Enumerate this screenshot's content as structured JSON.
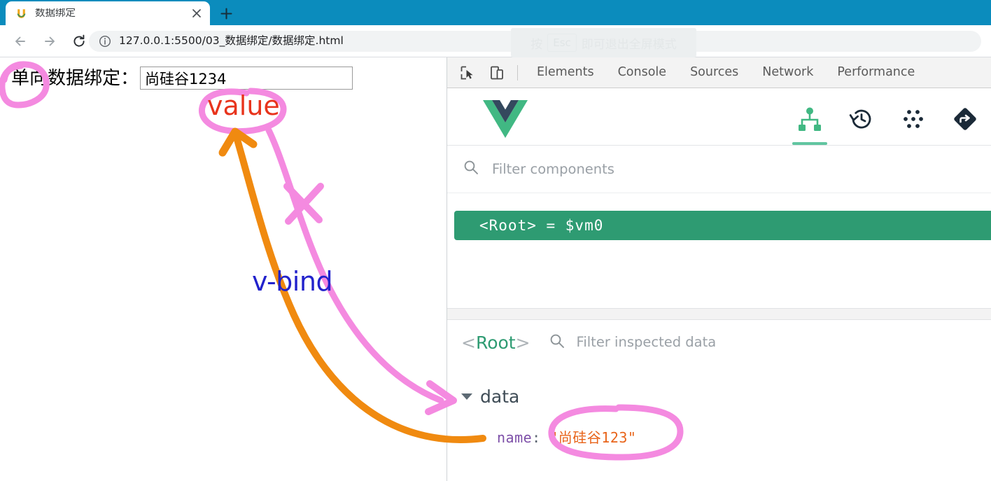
{
  "browser": {
    "tab": {
      "title": "数据绑定",
      "favicon_icon": "u-logo-favicon",
      "close_icon": "close-icon"
    },
    "new_tab_label": "+",
    "nav": {
      "back_icon": "arrow-left-icon",
      "forward_icon": "arrow-right-icon",
      "reload_icon": "reload-icon"
    },
    "omnibox": {
      "info_icon": "info-circle-icon",
      "url": "127.0.0.1:5500/03_数据绑定/数据绑定.html"
    },
    "fullscreen_hint": {
      "prefix": "按",
      "key": "Esc",
      "suffix": "即可退出全屏模式"
    }
  },
  "page": {
    "label": "单向数据绑定：",
    "input_value": "尚硅谷1234",
    "input_placeholder": ""
  },
  "devtools": {
    "inspect_icon": "inspect-element-icon",
    "device_icon": "device-toolbar-icon",
    "tabs": [
      {
        "label": "Elements"
      },
      {
        "label": "Console"
      },
      {
        "label": "Sources"
      },
      {
        "label": "Network"
      },
      {
        "label": "Performance"
      }
    ],
    "vue": {
      "logo_icon": "vue-logo-icon",
      "actions": [
        {
          "name": "components-tab-icon",
          "active": true
        },
        {
          "name": "timeline-history-icon",
          "active": false
        },
        {
          "name": "vuex-dots-icon",
          "active": false
        },
        {
          "name": "router-diamond-icon",
          "active": false
        }
      ],
      "filter": {
        "search_icon": "search-icon",
        "placeholder": "Filter components"
      },
      "tree": [
        {
          "label": "<Root> = $vm0",
          "selected": true
        }
      ],
      "inspector": {
        "component_open": "<",
        "component_name": "Root",
        "component_close": ">",
        "search_icon": "search-icon",
        "filter_placeholder": "Filter inspected data",
        "group_label": "data",
        "group_expanded": true,
        "props": [
          {
            "key": "name",
            "separator": ": ",
            "value": "\"尚硅谷123\""
          }
        ]
      }
    }
  },
  "annotations": {
    "value_label": "value",
    "vbind_label": "v-bind",
    "colors": {
      "pink": "#f48ae0",
      "orange": "#f08a10",
      "red": "#e8341c",
      "blue": "#2222cc"
    }
  }
}
